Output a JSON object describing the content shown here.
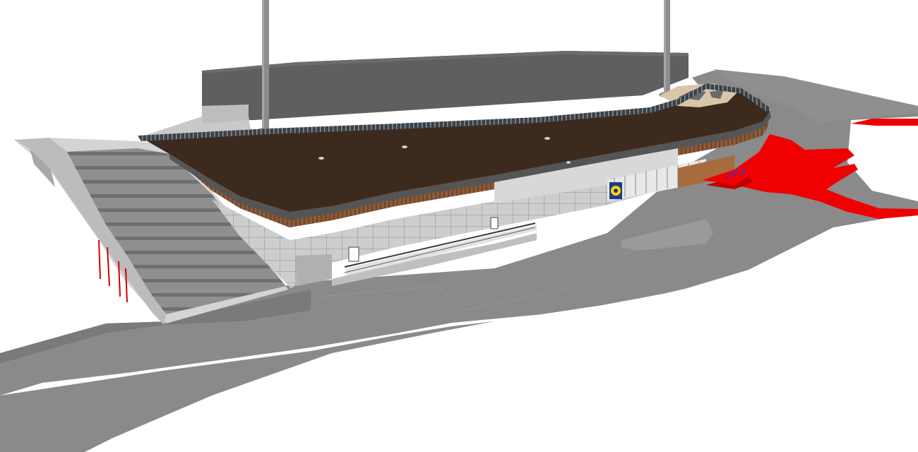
{
  "scene": {
    "kind": "3d-building-model-view",
    "background_color": "#ffffff",
    "colors": {
      "ground": "#8a8a8a",
      "ground_dark": "#767676",
      "ground_light": "#a2a2a2",
      "backdrop_block": "#5e5e5e",
      "backdrop_top": "#6c6c6c",
      "pylon": "#8c8c8c",
      "roof": "#3d2a1e",
      "roof_edge": "#2b2b2b",
      "facade_wood": "#8a5a3a",
      "facade_stone": "#c9c9c9",
      "stair": "#9a9a9a",
      "wall": "#d2d2d2",
      "glass": "#e6e6e6",
      "highlight_red": "#f00000",
      "railing": "#333a40",
      "deck_light": "#d8c6a8"
    },
    "objects": [
      "backdrop-block",
      "light-pylon-left",
      "light-pylon-right",
      "grand-staircase",
      "curved-roof",
      "roof-railing",
      "timber-facade",
      "stone-base-wall",
      "glazed-entrance",
      "shop-logo-sign",
      "access-ramp",
      "red-highlighted-surface",
      "ground-plane"
    ]
  }
}
